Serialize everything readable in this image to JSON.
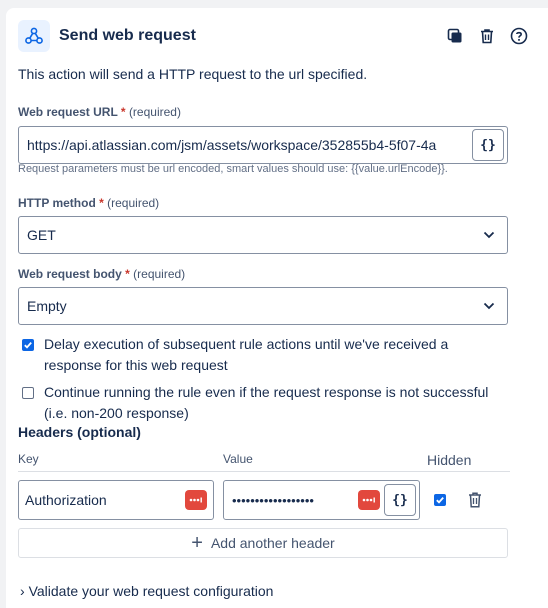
{
  "header": {
    "title": "Send web request",
    "icons": [
      "webhook-icon",
      "duplicate-icon",
      "trash-icon",
      "help-icon"
    ]
  },
  "description": "This action will send a HTTP request to the url specified.",
  "url_field": {
    "label": "Web request URL",
    "required_star": "*",
    "required_text": "(required)",
    "value": "https://api.atlassian.com/jsm/assets/workspace/352855b4-5f07-4a",
    "smart_value_label": "{}",
    "hint": "Request parameters must be url encoded, smart values should use: {{value.urlEncode}}."
  },
  "method_field": {
    "label": "HTTP method",
    "required_star": "*",
    "required_text": "(required)",
    "value": "GET"
  },
  "body_field": {
    "label": "Web request body",
    "required_star": "*",
    "required_text": "(required)",
    "value": "Empty"
  },
  "options": {
    "delay": {
      "checked": true,
      "label": "Delay execution of subsequent rule actions until we've received a response for this web request"
    },
    "continue": {
      "checked": false,
      "label": "Continue running the rule even if the request response is not successful (i.e. non-200 response)"
    }
  },
  "headers": {
    "title": "Headers (optional)",
    "col_key": "Key",
    "col_value": "Value",
    "col_hidden": "Hidden",
    "rows": [
      {
        "key": "Authorization",
        "value_masked": "••••••••••••••••••",
        "smart_value_label": "{}",
        "hidden": true
      }
    ],
    "add_label": "Add another header",
    "add_icon": "+"
  },
  "partial_bottom_text": "Validate your web request configuration"
}
